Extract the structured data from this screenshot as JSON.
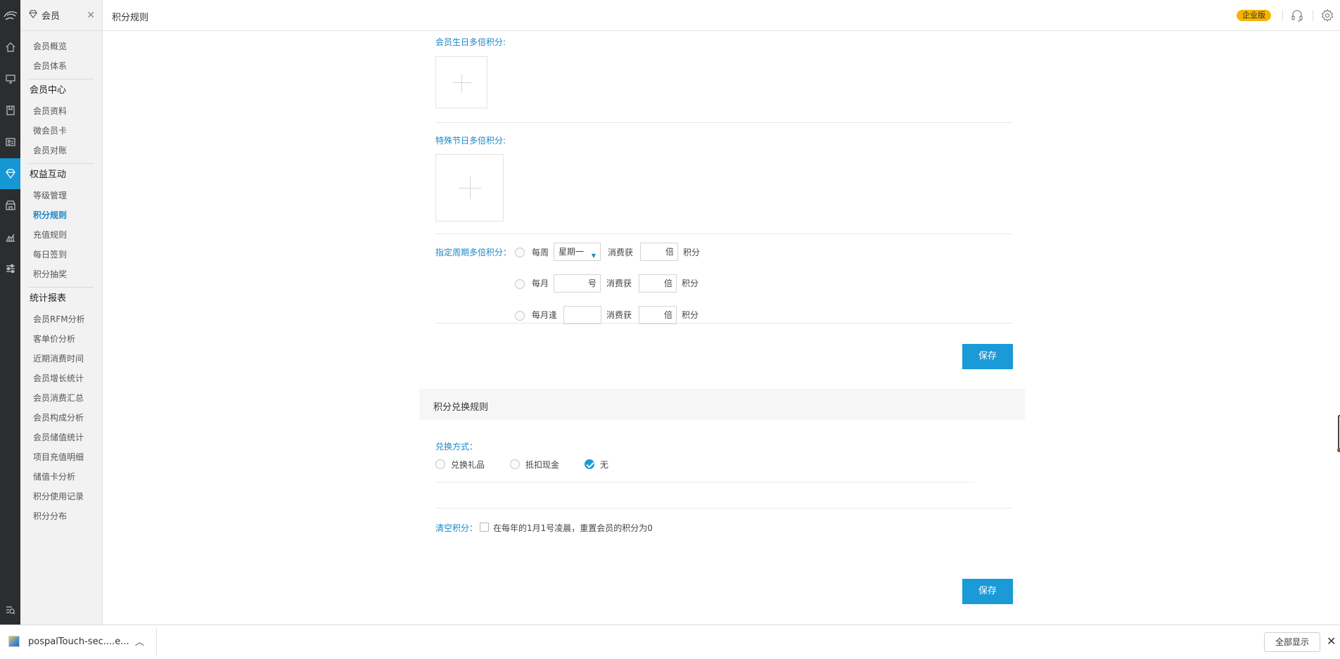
{
  "rail": {
    "icons": [
      "logo-icon",
      "home-icon",
      "monitor-icon",
      "book-icon",
      "id-card-icon",
      "member-diamond-icon",
      "store-icon",
      "chart-icon",
      "sliders-icon",
      "search-list-icon"
    ]
  },
  "menu": {
    "title": "会员",
    "items_top": [
      "会员概览",
      "会员体系"
    ],
    "group_center": "会员中心",
    "items_center": [
      "会员资料",
      "微会员卡",
      "会员对账"
    ],
    "group_rights": "权益互动",
    "items_rights": [
      "等级管理",
      "积分规则",
      "充值规则",
      "每日签到",
      "积分抽奖"
    ],
    "active_item": "积分规则",
    "group_reports": "统计报表",
    "items_reports": [
      "会员RFM分析",
      "客单价分析",
      "近期消费时间",
      "会员增长统计",
      "会员消费汇总",
      "会员构成分析",
      "会员储值统计",
      "项目充值明细",
      "储值卡分析",
      "积分使用记录",
      "积分分布"
    ]
  },
  "topbar": {
    "title": "积分规则",
    "badge": "企业版",
    "icons": [
      "headset-icon",
      "settings-icon"
    ]
  },
  "form": {
    "birthday_label": "会员生日多倍积分:",
    "holiday_label": "特殊节日多倍积分:",
    "period_label": "指定周期多倍积分：",
    "weekly": {
      "prefix": "每周",
      "select_value": "星期一",
      "consume": "消费获",
      "times": "倍",
      "points": "积分"
    },
    "monthly": {
      "prefix": "每月",
      "day_unit": "号",
      "consume": "消费获",
      "times": "倍",
      "points": "积分"
    },
    "monthly_every": {
      "prefix": "每月逢",
      "consume": "消费获",
      "times": "倍",
      "points": "积分"
    },
    "save_label": "保存"
  },
  "exchange": {
    "section_title": "积分兑换规则",
    "mode_label": "兑换方式：",
    "options": [
      "兑换礼品",
      "抵扣现金",
      "无"
    ],
    "selected": "无",
    "clear_label": "清空积分：",
    "clear_text": "在每年的1月1号凌晨，重置会员的积分为0",
    "save_label": "保存"
  },
  "downloads": {
    "filename": "pospalTouch-sec....e...",
    "show_all": "全部显示"
  },
  "colors": {
    "accent": "#1a9ad6",
    "badge": "#f5b400",
    "rail_bg": "#2b2d30"
  }
}
